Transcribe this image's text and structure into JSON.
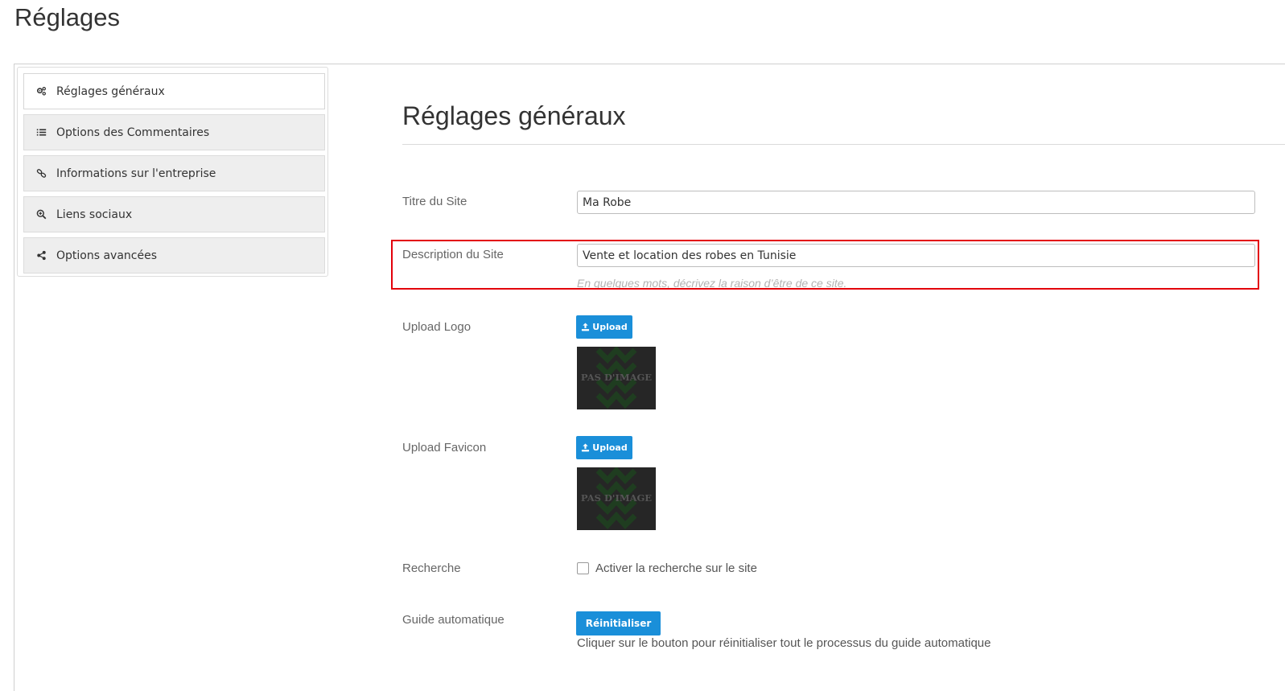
{
  "page": {
    "title": "Réglages"
  },
  "sidebar": {
    "items": [
      {
        "label": "Réglages généraux",
        "icon": "gears-icon",
        "active": true
      },
      {
        "label": "Options des Commentaires",
        "icon": "list-icon",
        "active": false
      },
      {
        "label": "Informations sur l'entreprise",
        "icon": "link-icon",
        "active": false
      },
      {
        "label": "Liens sociaux",
        "icon": "search-plus-icon",
        "active": false
      },
      {
        "label": "Options avancées",
        "icon": "share-icon",
        "active": false
      }
    ]
  },
  "main": {
    "section_title": "Réglages généraux",
    "site_title": {
      "label": "Titre du Site",
      "value": "Ma Robe"
    },
    "site_description": {
      "label": "Description du Site",
      "value": "Vente et location des robes en Tunisie",
      "help": "En quelques mots, décrivez la raison d’être de ce site."
    },
    "logo": {
      "label": "Upload Logo",
      "button_label": "Upload",
      "placeholder_text": "PAS D'IMAGE"
    },
    "favicon": {
      "label": "Upload Favicon",
      "button_label": "Upload",
      "placeholder_text": "PAS D'IMAGE"
    },
    "search": {
      "label": "Recherche",
      "checkbox_label": "Activer la recherche sur le site",
      "checked": false
    },
    "guide": {
      "label": "Guide automatique",
      "button_label": "Réinitialiser",
      "description": "Cliquer sur le bouton pour réinitialiser tout le processus du guide automatique"
    }
  },
  "colors": {
    "accent": "#1a8fd9",
    "highlight": "#e3000b"
  }
}
